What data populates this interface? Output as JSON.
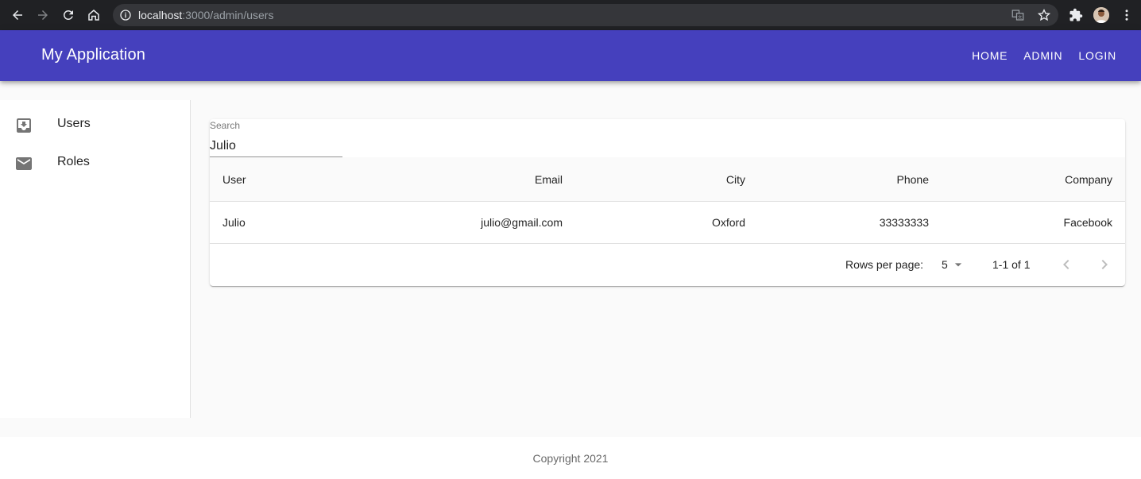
{
  "browser": {
    "url_host": "localhost",
    "url_path": ":3000/admin/users",
    "icons": [
      "back-icon",
      "forward-icon",
      "reload-icon",
      "home-icon",
      "info-icon",
      "translate-icon",
      "star-icon",
      "extensions-icon",
      "avatar",
      "menu-icon"
    ]
  },
  "appbar": {
    "title": "My Application",
    "nav": [
      "HOME",
      "ADMIN",
      "LOGIN"
    ],
    "color": "#4540bd"
  },
  "sidebar": {
    "items": [
      {
        "label": "Users",
        "icon": "move-to-inbox-icon"
      },
      {
        "label": "Roles",
        "icon": "mail-icon"
      }
    ]
  },
  "search": {
    "label": "Search",
    "value": "Julio"
  },
  "table": {
    "columns": [
      "User",
      "Email",
      "City",
      "Phone",
      "Company"
    ],
    "rows": [
      {
        "user": "Julio",
        "email": "julio@gmail.com",
        "city": "Oxford",
        "phone": "33333333",
        "company": "Facebook"
      }
    ],
    "pagination": {
      "rows_per_page_label": "Rows per page:",
      "rows_per_page": "5",
      "range": "1-1 of 1"
    }
  },
  "footer": {
    "copyright": "Copyright 2021"
  }
}
